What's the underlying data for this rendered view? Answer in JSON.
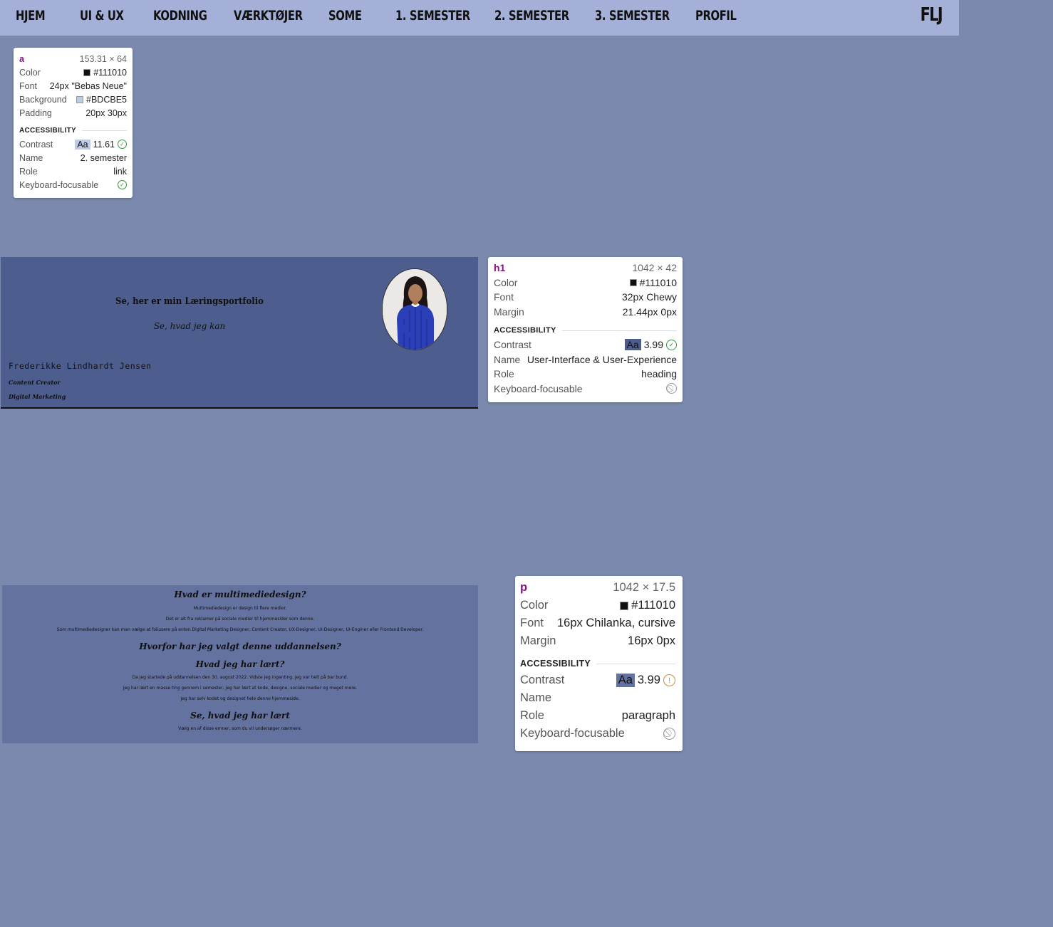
{
  "nav": {
    "items": [
      "HJEM",
      "UI & UX",
      "KODNING",
      "VÆRKTØJER",
      "SOME",
      "1. SEMESTER",
      "2. SEMESTER",
      "3. SEMESTER",
      "PROFIL"
    ],
    "logo": "FLJ"
  },
  "tooltips": {
    "a": {
      "tag": "a",
      "size": "153.31 × 64",
      "color_label": "Color",
      "color_value": "#111010",
      "font_label": "Font",
      "font_value": "24px \"Bebas Neue\"",
      "background_label": "Background",
      "background_value": "#BDCBE5",
      "padding_label": "Padding",
      "padding_value": "20px 30px",
      "accessibility": "ACCESSIBILITY",
      "contrast_label": "Contrast",
      "contrast_sample": "Aa",
      "contrast_value": "11.61",
      "name_label": "Name",
      "name_value": "2. semester",
      "role_label": "Role",
      "role_value": "link",
      "focus_label": "Keyboard-focusable"
    },
    "h1": {
      "tag": "h1",
      "size": "1042 × 42",
      "color_label": "Color",
      "color_value": "#111010",
      "font_label": "Font",
      "font_value": "32px Chewy",
      "margin_label": "Margin",
      "margin_value": "21.44px 0px",
      "accessibility": "ACCESSIBILITY",
      "contrast_label": "Contrast",
      "contrast_sample": "Aa",
      "contrast_value": "3.99",
      "name_label": "Name",
      "name_value": "User-Interface & User-Experience",
      "role_label": "Role",
      "role_value": "heading",
      "focus_label": "Keyboard-focusable"
    },
    "p": {
      "tag": "p",
      "size": "1042 × 17.5",
      "color_label": "Color",
      "color_value": "#111010",
      "font_label": "Font",
      "font_value": "16px Chilanka, cursive",
      "margin_label": "Margin",
      "margin_value": "16px 0px",
      "accessibility": "ACCESSIBILITY",
      "contrast_label": "Contrast",
      "contrast_sample": "Aa",
      "contrast_value": "3.99",
      "name_label": "Name",
      "name_value": "",
      "role_label": "Role",
      "role_value": "paragraph",
      "focus_label": "Keyboard-focusable"
    }
  },
  "hero": {
    "title": "Se, her er min Læringsportfolio",
    "subtitle": "Se, hvad jeg kan",
    "name": "Frederikke Lindhardt Jensen",
    "role1": "Content Creator",
    "role2": "Digital Marketing"
  },
  "content": {
    "h1": "Hvad er multimediedesign?",
    "p1": "Multimediedesign er design til flere medier.",
    "p2": "Det er alt fra reklamer på sociale medier til hjemmesider som denne.",
    "p3": "Som multimediedesigner kan man vælge at fokusere på enten Digital Marketing Designer, Content Creator, UX-Designer, UI-Designer, UI-Enginer eller Frontend Developer.",
    "h2": "Hvorfor har jeg valgt denne uddannelsen?",
    "h3": "Hvad jeg har lært?",
    "p4": "Da jeg startede på uddannelsen den 30. august 2022. Vidste jeg ingenting, jeg var helt på bar bund.",
    "p5": "Jeg har lært en masse ting gennem i semester, jeg har lært at kode, designe, sociale medier og meget mere.",
    "p6": "Jeg har selv kodet og designet hele denne hjemmeside.",
    "h4": "Se, hvad jeg har lært",
    "p7": "Vælg en af disse emner, som du vil undersøger nærmere."
  },
  "colors": {
    "page_bg": "#7a89ad",
    "nav_bg": "#a4b0d7",
    "hero_bg": "#4d5e8e",
    "content_bg": "#6472a0",
    "text": "#111010",
    "swatch_bg": "#BDCBE5"
  },
  "icons": [
    "check-circle-icon",
    "warning-circle-icon",
    "not-allowed-icon"
  ]
}
